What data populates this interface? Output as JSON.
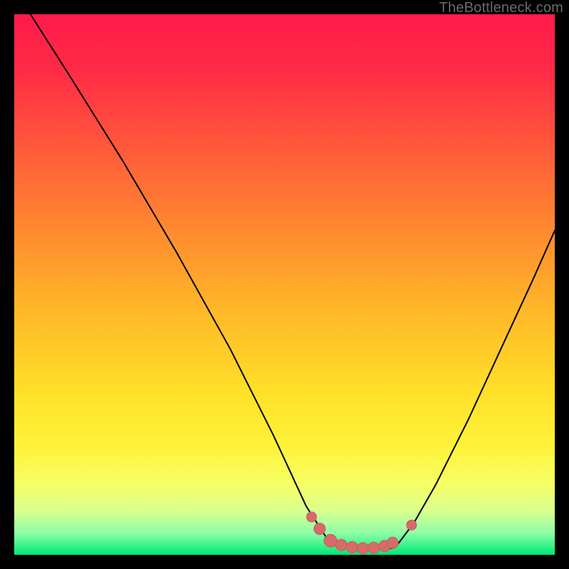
{
  "watermark": "TheBottleneck.com",
  "colors": {
    "black": "#000000",
    "curve": "#000000",
    "marker_fill": "#d86a6a",
    "marker_stroke": "#c85a5a",
    "gradient_stops": [
      {
        "offset": 0.0,
        "color": "#ff1a4b"
      },
      {
        "offset": 0.1,
        "color": "#ff2a46"
      },
      {
        "offset": 0.25,
        "color": "#ff5a3a"
      },
      {
        "offset": 0.4,
        "color": "#ff8a30"
      },
      {
        "offset": 0.55,
        "color": "#ffb828"
      },
      {
        "offset": 0.7,
        "color": "#ffe028"
      },
      {
        "offset": 0.8,
        "color": "#fff23a"
      },
      {
        "offset": 0.87,
        "color": "#f6ff66"
      },
      {
        "offset": 0.92,
        "color": "#d8ff90"
      },
      {
        "offset": 0.96,
        "color": "#8dffa8"
      },
      {
        "offset": 1.0,
        "color": "#00e878"
      }
    ]
  },
  "chart_data": {
    "type": "line",
    "title": "",
    "xlabel": "",
    "ylabel": "",
    "xlim": [
      0,
      100
    ],
    "ylim": [
      0,
      100
    ],
    "series": [
      {
        "name": "left_branch",
        "x": [
          3,
          10,
          20,
          30,
          40,
          48,
          54,
          58.5
        ],
        "y": [
          100,
          89,
          73,
          56,
          38,
          22,
          9,
          2
        ]
      },
      {
        "name": "right_branch",
        "x": [
          71,
          74,
          78,
          84,
          90,
          96,
          100
        ],
        "y": [
          2,
          6,
          13,
          25,
          38,
          51,
          60
        ]
      },
      {
        "name": "valley_floor",
        "x": [
          58.5,
          62,
          66,
          70,
          71
        ],
        "y": [
          2,
          1.2,
          1.0,
          1.2,
          2
        ]
      }
    ],
    "markers": {
      "name": "highlight_points",
      "color": "#d86a6a",
      "points": [
        {
          "x": 55.0,
          "y": 7.0,
          "r": 7
        },
        {
          "x": 56.5,
          "y": 4.8,
          "r": 8
        },
        {
          "x": 58.5,
          "y": 2.6,
          "r": 9
        },
        {
          "x": 60.5,
          "y": 1.8,
          "r": 8
        },
        {
          "x": 62.5,
          "y": 1.4,
          "r": 8
        },
        {
          "x": 64.5,
          "y": 1.2,
          "r": 8
        },
        {
          "x": 66.5,
          "y": 1.3,
          "r": 8
        },
        {
          "x": 68.5,
          "y": 1.6,
          "r": 8
        },
        {
          "x": 70.0,
          "y": 2.2,
          "r": 8
        },
        {
          "x": 73.5,
          "y": 5.5,
          "r": 7
        }
      ]
    }
  }
}
